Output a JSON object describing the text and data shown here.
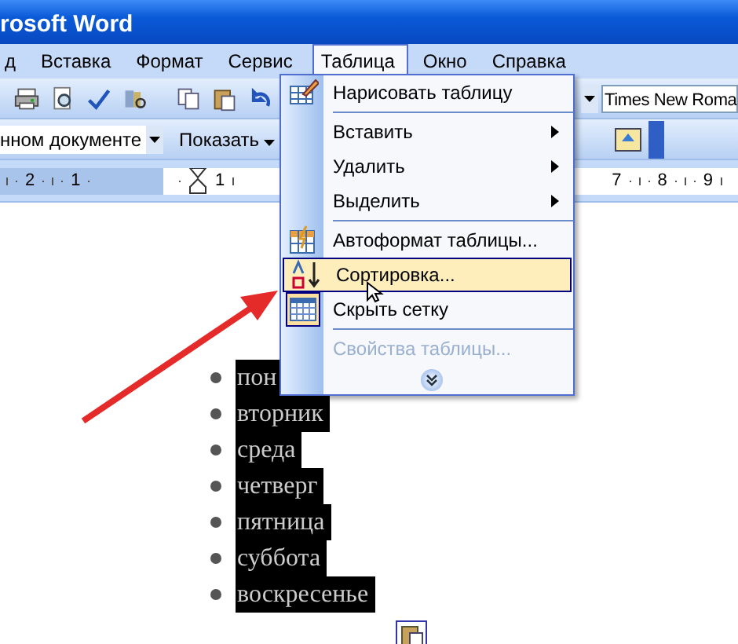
{
  "window": {
    "title": "rosoft Word"
  },
  "menu_bar": [
    {
      "label": "д",
      "selected": false
    },
    {
      "label": "Вставка",
      "selected": false
    },
    {
      "label": "Формат",
      "selected": false
    },
    {
      "label": "Сервис",
      "selected": false
    },
    {
      "label": "Таблица",
      "selected": true
    },
    {
      "label": "Окно",
      "selected": false
    },
    {
      "label": "Справка",
      "selected": false
    }
  ],
  "formatting": {
    "style_field": "нном документе",
    "show_button": "Показать",
    "font_field": "Times New Roma"
  },
  "ruler": {
    "left_labels": [
      "2",
      "1"
    ],
    "indent_labels": [
      "1"
    ],
    "right_labels": [
      "7",
      "8",
      "9"
    ]
  },
  "table_menu": [
    {
      "kind": "item",
      "label": "Нарисовать таблицу",
      "has_submenu": false,
      "disabled": false,
      "selected": false,
      "checked": false
    },
    {
      "kind": "separator"
    },
    {
      "kind": "item",
      "label": "Вставить",
      "has_submenu": true,
      "disabled": false,
      "selected": false,
      "checked": false
    },
    {
      "kind": "item",
      "label": "Удалить",
      "has_submenu": true,
      "disabled": false,
      "selected": false,
      "checked": false
    },
    {
      "kind": "item",
      "label": "Выделить",
      "has_submenu": true,
      "disabled": false,
      "selected": false,
      "checked": false
    },
    {
      "kind": "separator"
    },
    {
      "kind": "item",
      "label": "Автоформат таблицы...",
      "has_submenu": false,
      "disabled": false,
      "selected": false,
      "checked": false
    },
    {
      "kind": "item",
      "label": "Сортировка...",
      "has_submenu": false,
      "disabled": false,
      "selected": true,
      "checked": false
    },
    {
      "kind": "item",
      "label": "Скрыть сетку",
      "has_submenu": false,
      "disabled": false,
      "selected": false,
      "checked": true
    },
    {
      "kind": "separator"
    },
    {
      "kind": "item",
      "label": "Свойства таблицы...",
      "has_submenu": false,
      "disabled": true,
      "selected": false,
      "checked": false
    },
    {
      "kind": "expand"
    }
  ],
  "document": {
    "list": [
      {
        "text": "пон",
        "selected": true
      },
      {
        "text": "вторник",
        "selected": true
      },
      {
        "text": "среда",
        "selected": true
      },
      {
        "text": "четверг",
        "selected": true
      },
      {
        "text": "пятница",
        "selected": true
      },
      {
        "text": "суббота",
        "selected": true
      },
      {
        "text": "воскресенье",
        "selected": true
      }
    ]
  }
}
